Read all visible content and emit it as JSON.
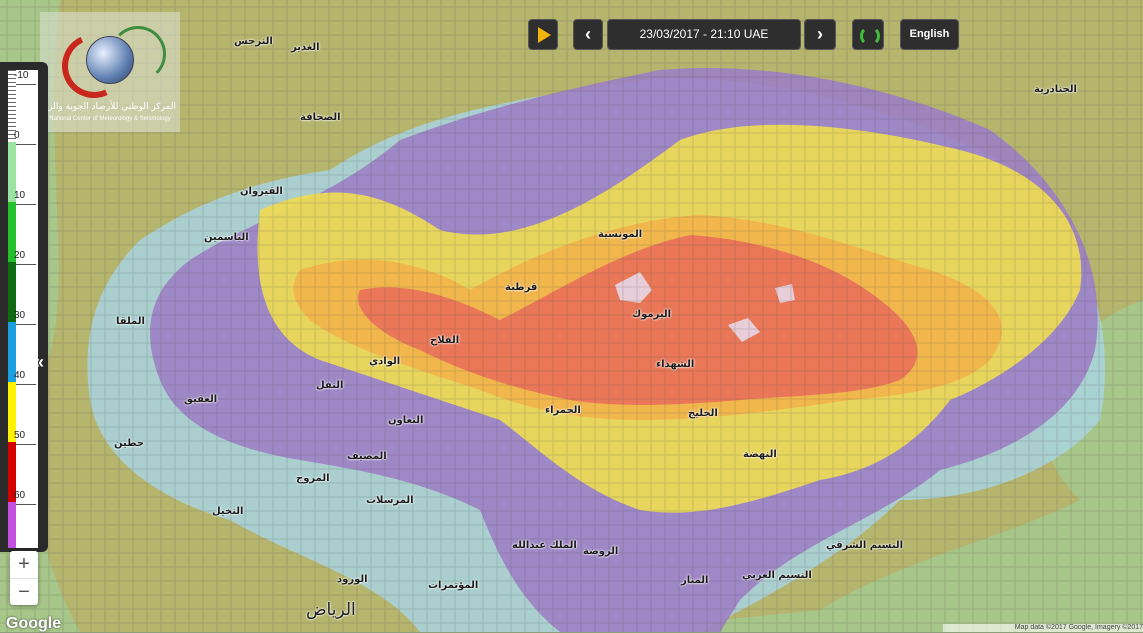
{
  "toolbar": {
    "date_time": "23/03/2017 - 21:10 UAE",
    "language_label": "English",
    "prev_symbol": "‹",
    "next_symbol": "›"
  },
  "logo": {
    "arabic_text": "المركز الوطني للأرصاد الجوية والزلازل",
    "english_text": "National Center of Meteorology & Seismology"
  },
  "legend": {
    "labels": [
      "-10",
      "0",
      "10",
      "20",
      "30",
      "40",
      "50",
      "60"
    ],
    "colors": [
      "#ffffff",
      "#9be3a0",
      "#25c12a",
      "#0f6b12",
      "#1a9fe0",
      "#fff200",
      "#d40000",
      "#c350e0"
    ],
    "toggle_symbol": "«"
  },
  "map": {
    "places": [
      {
        "name": "النرجس"
      },
      {
        "name": "الياسمين"
      },
      {
        "name": "الملقا"
      },
      {
        "name": "العقيق"
      },
      {
        "name": "حطين"
      },
      {
        "name": "النخيل"
      },
      {
        "name": "الغدير"
      },
      {
        "name": "النفل"
      },
      {
        "name": "التعاون"
      },
      {
        "name": "المصيف"
      },
      {
        "name": "المروج"
      },
      {
        "name": "المرسلات"
      },
      {
        "name": "الورود"
      },
      {
        "name": "المؤتمرات"
      },
      {
        "name": "الملك عبدالله"
      },
      {
        "name": "الصحافة"
      },
      {
        "name": "القيروان"
      },
      {
        "name": "الوادي"
      },
      {
        "name": "الفلاح"
      },
      {
        "name": "المونسية"
      },
      {
        "name": "قرطبة"
      },
      {
        "name": "اليرموك"
      },
      {
        "name": "الشهداء"
      },
      {
        "name": "الحمراء"
      },
      {
        "name": "الخليج"
      },
      {
        "name": "النهضة"
      },
      {
        "name": "الروضة"
      },
      {
        "name": "المنار"
      },
      {
        "name": "النسيم الغربي"
      },
      {
        "name": "النسيم الشرقي"
      },
      {
        "name": "الجنادرية"
      },
      {
        "name": "الرياض"
      }
    ]
  },
  "zoom": {
    "in_label": "+",
    "out_label": "−"
  },
  "attribution": {
    "google_label": "Google",
    "text": "Map data ©2017 Google, Imagery ©2017"
  }
}
